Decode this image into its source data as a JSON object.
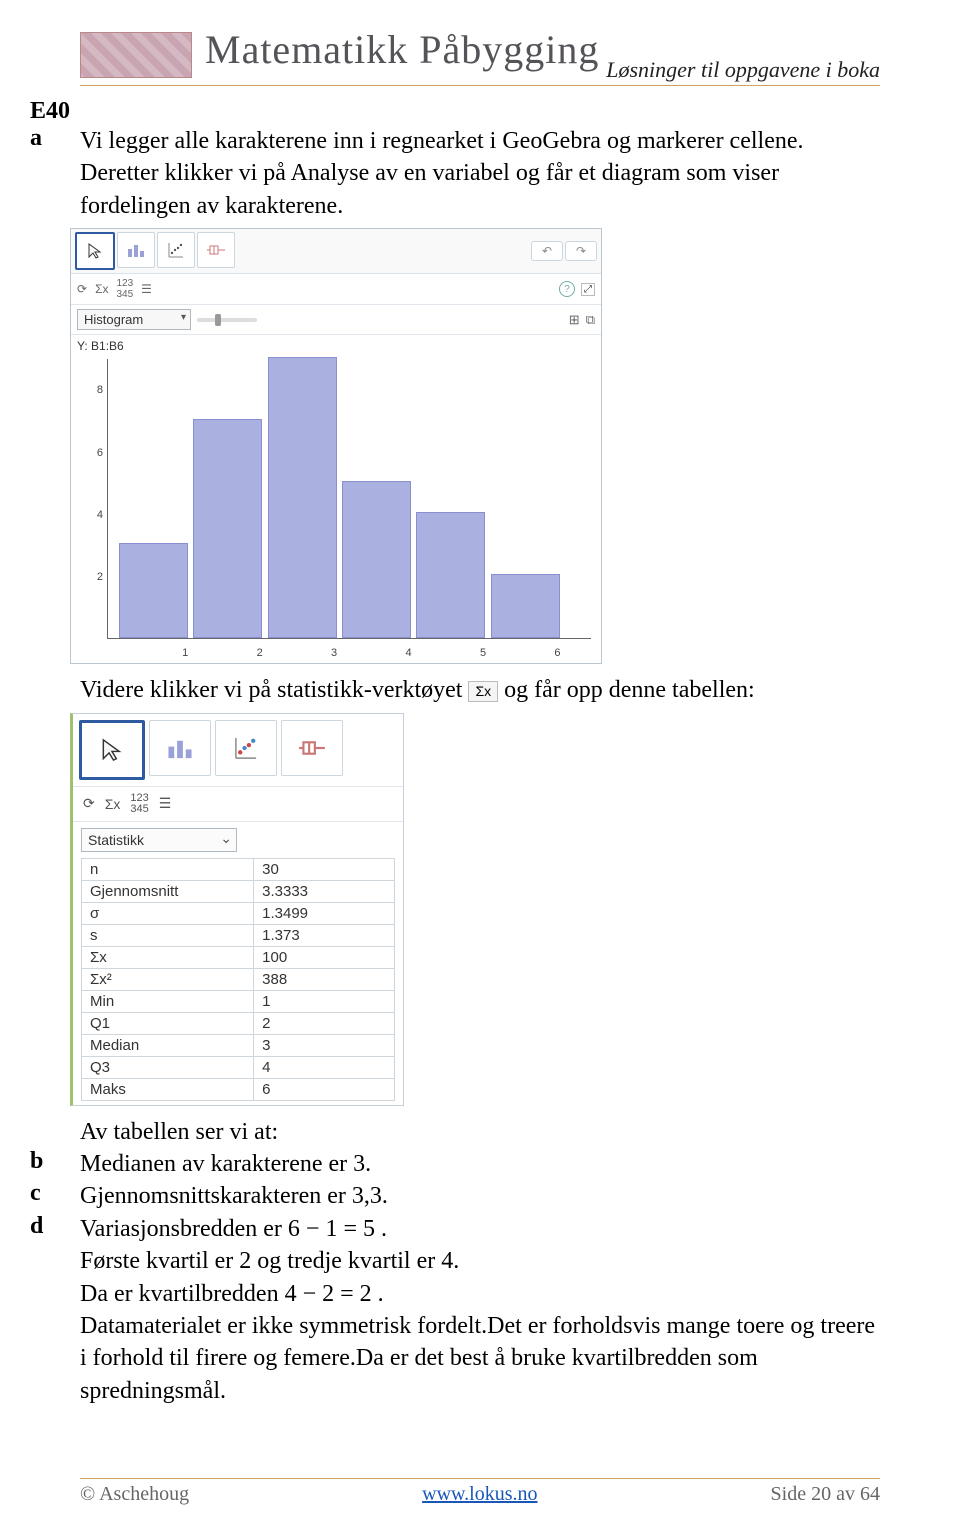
{
  "header": {
    "brand": "Matematikk Påbygging",
    "subtitle": "Løsninger til oppgavene i boka"
  },
  "exercise": "E40",
  "parts": {
    "a": "Vi legger alle karakterene inn i regnearket i GeoGebra og markerer cellene. Deretter klikker vi på Analyse av en variabel og får et diagram som viser fordelingen av karakterene.",
    "inter_1_pre": "Videre klikker vi på statistikk-verktøyet ",
    "inter_1_post": " og får opp denne tabellen:",
    "b_pre": "Av tabellen ser vi at:",
    "b": "Medianen av karakterene er 3.",
    "c": "Gjennomsnittskarakteren er 3,3.",
    "d1": "Variasjonsbredden er 6 − 1 = 5 .",
    "d2": "Første kvartil er 2 og tredje kvartil er 4.",
    "d3": "Da er kvartilbredden 4 − 2 = 2 .",
    "d4": "Datamaterialet er ikke symmetrisk fordelt.Det er forholdsvis mange toere og treere i forhold til firere og femere.Da er det best å bruke kvartilbredden som spredningsmål."
  },
  "histo": {
    "dropdown": "Histogram",
    "y_source": "Y: B1:B6"
  },
  "sigma_label": "Σx",
  "stats": {
    "dropdown": "Statistikk",
    "rows": [
      {
        "k": "n",
        "v": "30"
      },
      {
        "k": "Gjennomsnitt",
        "v": "3.3333"
      },
      {
        "k": "σ",
        "v": "1.3499"
      },
      {
        "k": "s",
        "v": "1.373"
      },
      {
        "k": "Σx",
        "v": "100"
      },
      {
        "k": "Σx²",
        "v": "388"
      },
      {
        "k": "Min",
        "v": "1"
      },
      {
        "k": "Q1",
        "v": "2"
      },
      {
        "k": "Median",
        "v": "3"
      },
      {
        "k": "Q3",
        "v": "4"
      },
      {
        "k": "Maks",
        "v": "6"
      }
    ]
  },
  "chart_data": {
    "type": "bar",
    "categories": [
      "1",
      "2",
      "3",
      "4",
      "5",
      "6"
    ],
    "values": [
      3,
      7,
      9,
      5,
      4,
      2
    ],
    "xlabel": "",
    "ylabel": "",
    "title": "",
    "ylim": [
      0,
      9
    ],
    "y_ticks": [
      2,
      4,
      6,
      8
    ]
  },
  "footer": {
    "left": "© Aschehoug",
    "mid": "www.lokus.no",
    "right": "Side 20 av 64"
  }
}
